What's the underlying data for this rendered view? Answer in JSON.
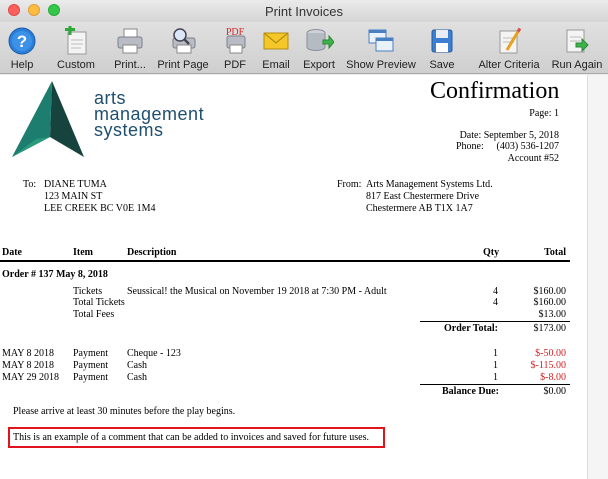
{
  "window": {
    "title": "Print Invoices"
  },
  "toolbar": {
    "buttons": [
      {
        "label": "Help",
        "icon": "help-icon"
      },
      {
        "label": "Custom",
        "icon": "custom-icon"
      },
      {
        "label": "Print...",
        "icon": "printer-icon"
      },
      {
        "label": "Print Page",
        "icon": "print-page-icon"
      },
      {
        "label": "PDF",
        "icon": "pdf-icon"
      },
      {
        "label": "Email",
        "icon": "email-icon"
      },
      {
        "label": "Export",
        "icon": "export-icon"
      },
      {
        "label": "Show Preview",
        "icon": "show-preview-icon"
      },
      {
        "label": "Save",
        "icon": "save-icon"
      },
      {
        "label": "Alter Criteria",
        "icon": "alter-criteria-icon"
      },
      {
        "label": "Run Again",
        "icon": "run-again-icon"
      }
    ],
    "pdf_icon_text": "PDF"
  },
  "doc": {
    "logo": {
      "line1": "arts",
      "line2": "management",
      "line3": "systems"
    },
    "title": "Confirmation",
    "page": "Page: 1",
    "date": "Date: September 5, 2018",
    "phone_label": "Phone:",
    "phone": "(403) 536-1207",
    "account": "Account #52",
    "to_label": "To:",
    "to": [
      "DIANE TUMA",
      "123 MAIN ST",
      "LEE CREEK BC  V0E 1M4"
    ],
    "from_label": "From:",
    "from": [
      "Arts Management Systems Ltd.",
      "817 East Chestermere Drive",
      "Chestermere  AB   T1X 1A7"
    ],
    "headers": {
      "date": "Date",
      "item": "Item",
      "description": "Description",
      "qty": "Qty",
      "total": "Total"
    },
    "order": "Order # 137   May 8, 2018",
    "lines": [
      {
        "item": "Tickets",
        "description": "Seussical! the Musical on November 19 2018 at 7:30 PM - Adult",
        "qty": "4",
        "total": "$160.00"
      },
      {
        "item": "Total Tickets",
        "description": "",
        "qty": "4",
        "total": "$160.00"
      },
      {
        "item": "Total Fees",
        "description": "",
        "qty": "",
        "total": "$13.00"
      }
    ],
    "order_total_label": "Order Total:",
    "order_total": "$173.00",
    "payments": [
      {
        "date": "MAY 8 2018",
        "item": "Payment",
        "description": "Cheque - 123",
        "qty": "1",
        "total": "$-50.00"
      },
      {
        "date": "MAY 8 2018",
        "item": "Payment",
        "description": "Cash",
        "qty": "1",
        "total": "$-115.00"
      },
      {
        "date": "MAY 29 2018",
        "item": "Payment",
        "description": "Cash",
        "qty": "1",
        "total": "$-8.00"
      }
    ],
    "balance_label": "Balance Due:",
    "balance": "$0.00",
    "note": "Please arrive at least 30 minutes before the play begins.",
    "comment": "This is an example of a comment that can be added to invoices and saved for future uses."
  },
  "colors": {
    "accent_red": "#d41f1f",
    "logo_teal": "#1a6f6a",
    "logo_navy": "#1f4f6e"
  }
}
